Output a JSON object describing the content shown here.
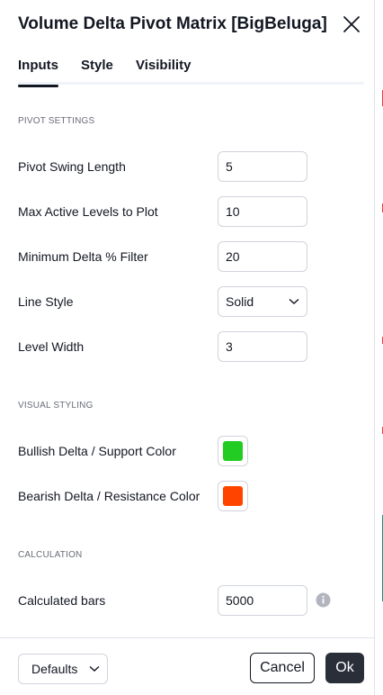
{
  "dialog": {
    "title": "Volume Delta Pivot Matrix [BigBeluga]",
    "close_icon": "close-icon"
  },
  "tabs": [
    {
      "label": "Inputs",
      "active": true
    },
    {
      "label": "Style",
      "active": false
    },
    {
      "label": "Visibility",
      "active": false
    }
  ],
  "sections": {
    "pivot": "PIVOT SETTINGS",
    "visual": "VISUAL STYLING",
    "calculation": "CALCULATION"
  },
  "inputs": {
    "pivot_swing_length": {
      "label": "Pivot Swing Length",
      "value": "5"
    },
    "max_active_levels": {
      "label": "Max Active Levels to Plot",
      "value": "10"
    },
    "min_delta_filter": {
      "label": "Minimum Delta % Filter",
      "value": "20"
    },
    "line_style": {
      "label": "Line Style",
      "value": "Solid"
    },
    "level_width": {
      "label": "Level Width",
      "value": "3"
    },
    "bullish_color": {
      "label": "Bullish Delta / Support Color",
      "color": "#22cc22"
    },
    "bearish_color": {
      "label": "Bearish Delta / Resistance Color",
      "color": "#ff4400"
    },
    "calculated_bars": {
      "label": "Calculated bars",
      "value": "5000",
      "icon": "info-icon"
    }
  },
  "footer": {
    "defaults_label": "Defaults",
    "cancel_label": "Cancel",
    "ok_label": "Ok"
  },
  "colors": {
    "text": "#131722",
    "ok_bg": "#2a2e39",
    "border": "#d1d4dc"
  }
}
